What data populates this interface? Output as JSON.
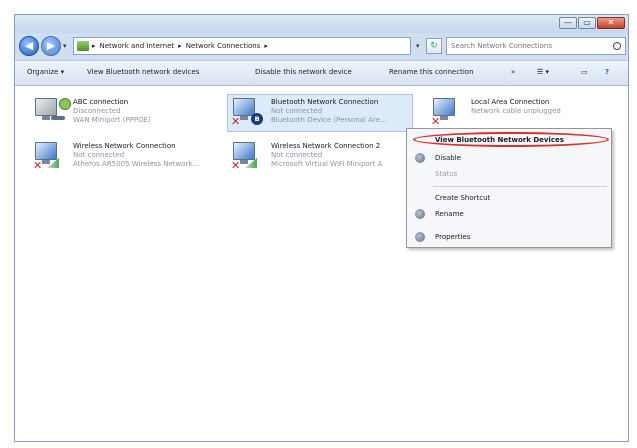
{
  "window": {
    "controls": {
      "minimize": "—",
      "maximize": "▭",
      "close": "✕"
    }
  },
  "navigation": {
    "back_glyph": "◀",
    "forward_glyph": "▶",
    "breadcrumb": [
      "Network and Internet",
      "Network Connections"
    ],
    "breadcrumb_separator": "▸",
    "refresh_glyph": "↻",
    "search_placeholder": "Search Network Connections"
  },
  "toolbar": {
    "organize": "Organize ▾",
    "view_bluetooth": "View Bluetooth network devices",
    "disable_device": "Disable this network device",
    "rename": "Rename this connection",
    "more": "»"
  },
  "connections": [
    {
      "name": "ABC connection",
      "status": "Disconnected",
      "device": "WAN Miniport (PPPOE)"
    },
    {
      "name": "Bluetooth Network Connection",
      "status": "Not connected",
      "device": "Bluetooth Device (Personal Are..."
    },
    {
      "name": "Local Area Connection",
      "status": "Network cable unplugged",
      "device": ""
    },
    {
      "name": "Wireless Network Connection",
      "status": "Not connected",
      "device": "Atheros AR5005 Wireless Network..."
    },
    {
      "name": "Wireless Network Connection 2",
      "status": "Not connected",
      "device": "Microsoft Virtual WiFi Miniport A"
    }
  ],
  "context_menu": {
    "view_devices": "View Bluetooth Network Devices",
    "disable": "Disable",
    "status": "Status",
    "create_shortcut": "Create Shortcut",
    "rename": "Rename",
    "properties": "Properties"
  },
  "colors": {
    "highlight_ring": "#d5332a",
    "selection": "#dceaf9"
  }
}
